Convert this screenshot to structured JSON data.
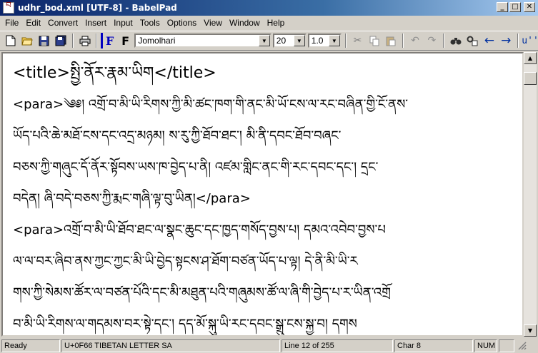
{
  "window": {
    "title": "udhr_bod.xml [UTF-8] - BabelPad",
    "app_icon_glyph": "བ",
    "minimize": "_",
    "maximize": "□",
    "close": "✕"
  },
  "menu": [
    "File",
    "Edit",
    "Convert",
    "Insert",
    "Input",
    "Tools",
    "Options",
    "View",
    "Window",
    "Help"
  ],
  "toolbar": {
    "font_name": "Jomolhari",
    "font_size": "20",
    "line_spacing": "1.0",
    "icons": {
      "new": "new-file-icon",
      "open": "open-folder-icon",
      "save": "save-icon",
      "save_all": "save-all-icon",
      "print": "print-icon",
      "font_f1": "F",
      "font_f2": "F",
      "cut": "cut-icon",
      "copy": "copy-icon",
      "paste": "paste-icon",
      "undo": "undo-icon",
      "redo": "redo-icon",
      "find": "find-icon",
      "replace": "replace-icon",
      "back": "back-arrow-icon",
      "forward": "forward-arrow-icon",
      "unicode": "u''"
    }
  },
  "document": {
    "lines": [
      "<title>སྤྱི་ནོར་རྣམ་ཡིག</title>",
      "<para>༄༅། འགྲོ་བ་མི་ཡི་རིགས་ཀྱི་མི་ཚང་ཁག་གི་ནང་མི་ཡོ་ངས་ལ་རང་བཞིན་གྱི་ངོ་ནས་",
      "ཡོད་པའི་ཆེ་མཐོ་ངས་དང་འདྲ་མཉམ། ས་རུ་ཀྱི་ཐོབ་ཐང་། མི་ནི་དབང་ཐོབ་བཞང་",
      "བཅས་ཀྱི་གཞུང་དོ་ནོར་སྟོབས་ཡས་ཁ་བྱེད་པ་ནི། འཛམ་གླིང་ནང་གི་རང་དབང་དང་། དྲང་",
      "བདེན། ཞི་བདེ་བཅས་ཀྱི་རྨང་གཞི་ལྟ་བུ་ཡིན།</para>",
      "<para>འགྲོ་བ་མི་ཡི་ཐོབ་ཐང་ལ་སྣང་ཆུང་དང་ཁྱད་གསོད་བྱས་པ། དམའ་འབེབ་བྱས་པ",
      "ལ་ལ་བར་ཞིབ་ནས་ཀྱང་ཀྱང་མི་ཡི་བྱེད་སྟངས་ཤ་ཐོག་བཙན་ཡོད་པ་ལྟ། དེ་ནི་མི་ཡི་ར",
      "གས་ཀྱི་སེམས་ཚོར་ལ་བཙན་པོའི་དང་མི་མཐུན་པའི་གཞུམས་ཚོ་ལ་ཞི་གི་བྱེད་པ་ར་ཡིན་འགྲོ",
      "བ་མི་ཡི་རིགས་ལ་གདམས་བར་སྟེ་དང་། དད་མོ་སྐུ་ཡི་རང་དབང་སྒྲུ་ངས་སྐྱ་བ། དགས"
    ]
  },
  "status": {
    "state": "Ready",
    "char_name": "U+0F66 TIBETAN LETTER SA",
    "line_info": "Line 12 of 255",
    "char_info": "Char 8",
    "num": "NUM"
  }
}
